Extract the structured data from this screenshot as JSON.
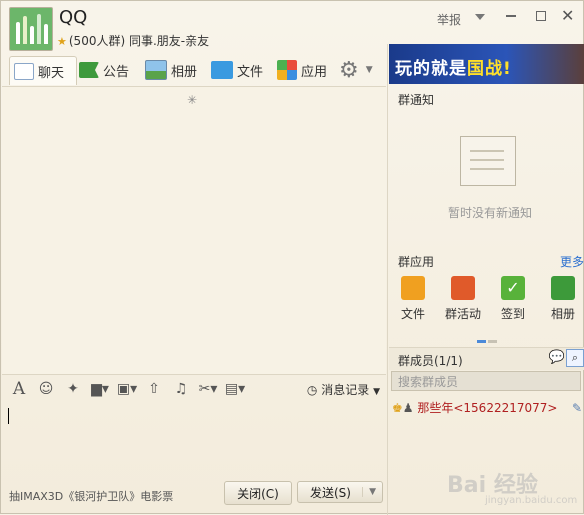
{
  "header": {
    "title": "QQ",
    "subtitle": "(500人群) 同事.朋友-亲友",
    "report_label": "举报"
  },
  "tabs": [
    {
      "label": "聊天",
      "icon": "chat-bubble-icon",
      "active": true
    },
    {
      "label": "公告",
      "icon": "megaphone-flag-icon"
    },
    {
      "label": "相册",
      "icon": "photo-album-icon"
    },
    {
      "label": "文件",
      "icon": "folder-icon"
    },
    {
      "label": "应用",
      "icon": "apps-grid-icon"
    }
  ],
  "banner": {
    "text_prefix": "玩的就是",
    "text_highlight": "国战!"
  },
  "notice": {
    "title": "群通知",
    "empty_text": "暂时没有新通知"
  },
  "group_apps": {
    "title": "群应用",
    "more_label": "更多",
    "items": [
      {
        "label": "文件",
        "color": "#f0a020"
      },
      {
        "label": "群活动",
        "color": "#e05a2a"
      },
      {
        "label": "签到",
        "color": "#58b23a"
      },
      {
        "label": "相册",
        "color": "#3d9a3a"
      }
    ]
  },
  "members": {
    "title": "群成员(1/1)",
    "search_placeholder": "搜索群成员",
    "list": [
      {
        "name": "那些年<15622217077>"
      }
    ]
  },
  "toolbar": {
    "history_label": "消息记录"
  },
  "footer": {
    "ad_text": "抽IMAX3D《银河护卫队》电影票",
    "close_button": "关闭(C)",
    "send_button": "发送(S)"
  },
  "watermark": {
    "text": "Bai 经验",
    "sub": "jingyan.baidu.com"
  },
  "colors": {
    "accent_blue": "#2b6fcf",
    "member_red": "#b02020",
    "background": "#f7f2e5"
  }
}
